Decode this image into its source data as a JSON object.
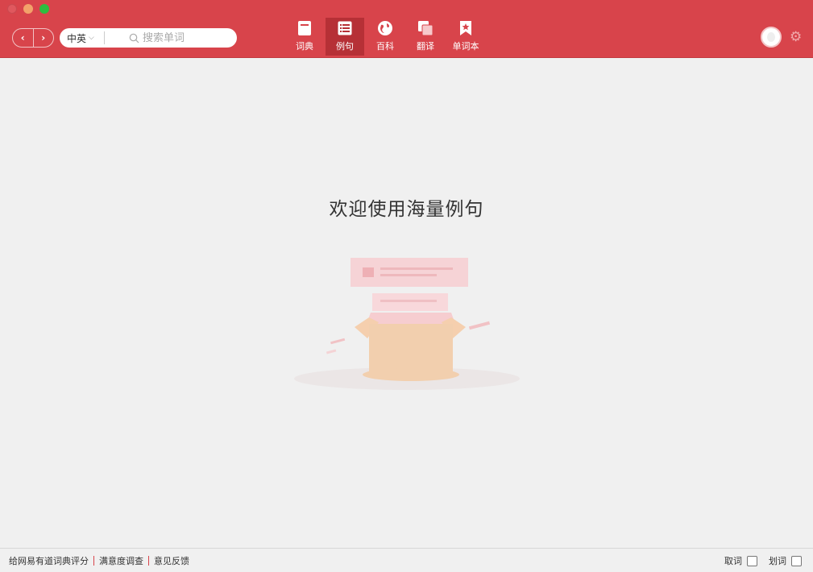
{
  "toolbar": {
    "back_label": "‹",
    "forward_label": "›",
    "lang_label": "中英",
    "search_placeholder": "搜索单词",
    "tabs": [
      {
        "label": "词典"
      },
      {
        "label": "例句"
      },
      {
        "label": "百科"
      },
      {
        "label": "翻译"
      },
      {
        "label": "单词本"
      }
    ]
  },
  "main": {
    "welcome": "欢迎使用海量例句"
  },
  "footer": {
    "links": [
      "给网易有道词典评分",
      "满意度调查",
      "意见反馈"
    ],
    "quci_label": "取词",
    "huaci_label": "划词"
  },
  "colors": {
    "brand": "#d8444b",
    "active_tab": "#b63036"
  }
}
